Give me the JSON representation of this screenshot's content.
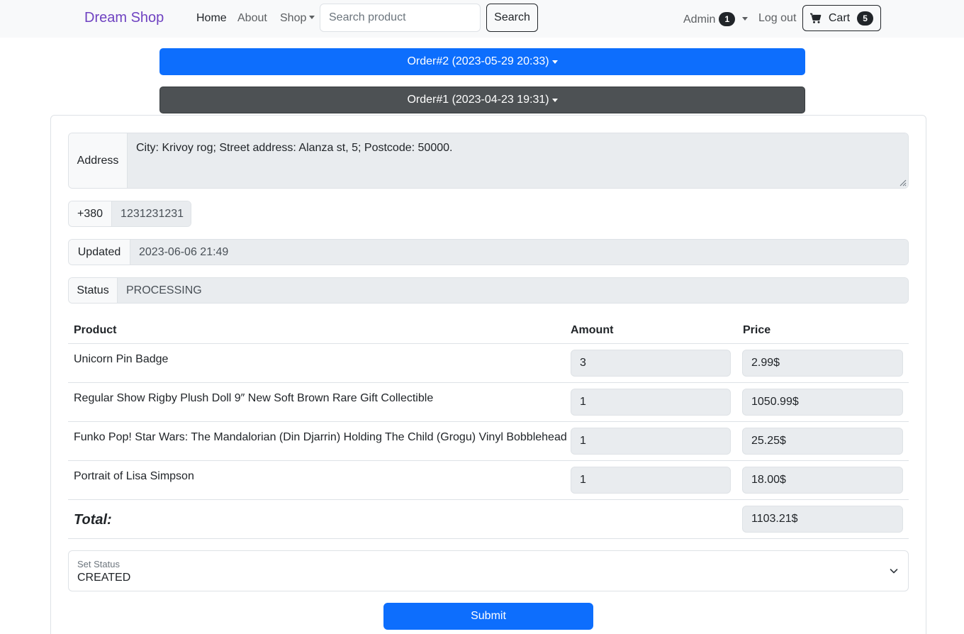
{
  "navbar": {
    "brand": "Dream Shop",
    "home": "Home",
    "about": "About",
    "shop": "Shop",
    "search_placeholder": "Search product",
    "search_button": "Search",
    "admin": "Admin",
    "admin_badge": "1",
    "logout": "Log out",
    "cart": "Cart",
    "cart_badge": "5",
    "brand_color": "#6f42c1"
  },
  "orders": [
    {
      "label": "Order#2 (2023-05-29 20:33)",
      "color": "#0d6efd"
    },
    {
      "label": "Order#1 (2023-04-23 19:31)",
      "color": "#4d5154"
    }
  ],
  "details": {
    "address_label": "Address",
    "address_value": "City: Krivoy rog; Street address: Alanza st, 5; Postcode: 50000.",
    "phone_code": "+380",
    "phone_number": "1231231231",
    "updated_label": "Updated",
    "updated_value": "2023-06-06 21:49",
    "status_label": "Status",
    "status_value": "PROCESSING"
  },
  "table": {
    "headers": {
      "product": "Product",
      "amount": "Amount",
      "price": "Price"
    },
    "rows": [
      {
        "product": "Unicorn Pin Badge",
        "amount": "3",
        "price": "2.99$"
      },
      {
        "product": "Regular Show Rigby Plush Doll 9″ New Soft Brown Rare Gift Collectible",
        "amount": "1",
        "price": "1050.99$"
      },
      {
        "product": "Funko Pop! Star Wars: The Mandalorian (Din Djarrin) Holding The Child (Grogu) Vinyl Bobblehead",
        "amount": "1",
        "price": "25.25$"
      },
      {
        "product": "Portrait of Lisa Simpson",
        "amount": "1",
        "price": "18.00$"
      }
    ],
    "total_label": "Total:",
    "total_value": "1103.21$"
  },
  "form": {
    "set_status_label": "Set Status",
    "set_status_value": "CREATED",
    "submit": "Submit"
  }
}
